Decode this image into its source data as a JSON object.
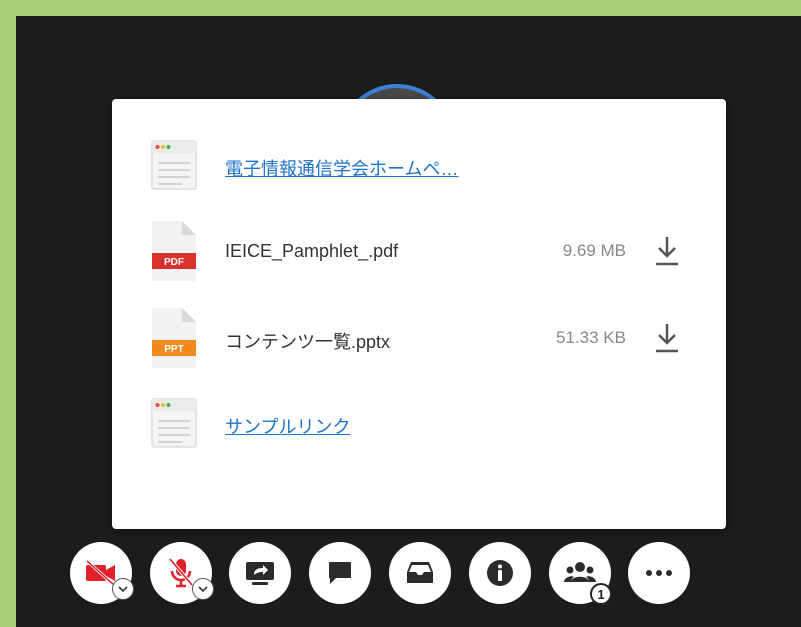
{
  "files_panel": {
    "items": [
      {
        "type": "link",
        "name": "電子情報通信学会ホームペ…"
      },
      {
        "type": "file",
        "name": "IEICE_Pamphlet_.pdf",
        "size": "9.69 MB",
        "badge": "PDF",
        "badge_color": "#d9302b"
      },
      {
        "type": "file",
        "name": "コンテンツ一覧.pptx",
        "size": "51.33 KB",
        "badge": "PPT",
        "badge_color": "#f08a1c"
      },
      {
        "type": "link",
        "name": "サンプルリンク"
      }
    ]
  },
  "toolbar": {
    "buttons": [
      "camera-off",
      "mic-off",
      "share-screen",
      "chat",
      "files-inbox",
      "info",
      "participants",
      "more"
    ],
    "participants_count": "1",
    "camera_off_color": "#e0202a"
  }
}
